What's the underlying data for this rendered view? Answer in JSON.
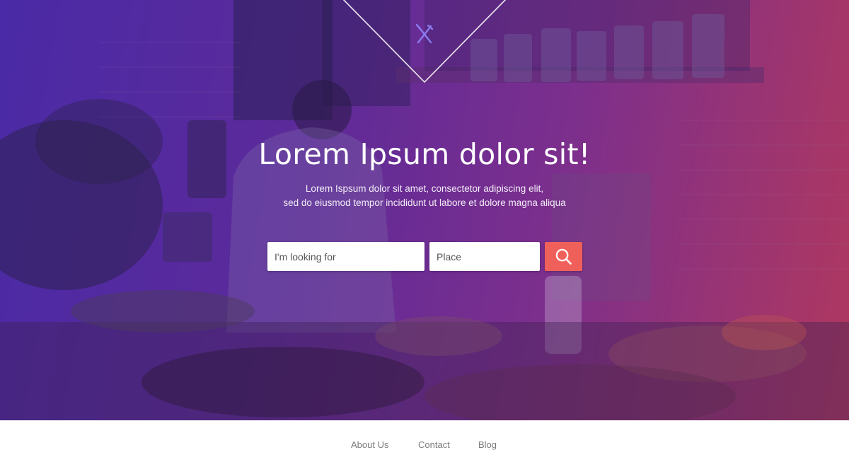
{
  "hero": {
    "title": "Lorem Ipsum dolor sit!",
    "subtitle_line1": "Lorem Ispsum dolor sit amet, consectetor adipiscing elit,",
    "subtitle_line2": "sed do eiusmod tempor incididunt ut labore et dolore magna aliqua",
    "logo_icon": "fork-knife-icon"
  },
  "search": {
    "what_placeholder": "I'm looking for",
    "place_placeholder": "Place",
    "button_icon": "search-icon"
  },
  "footer": {
    "links": [
      {
        "label": "About Us"
      },
      {
        "label": "Contact"
      },
      {
        "label": "Blog"
      }
    ]
  },
  "colors": {
    "gradient_left": "#4a2aa6",
    "gradient_right": "#b0385f",
    "accent": "#f0605b",
    "footer_text": "#7a7a7a"
  }
}
